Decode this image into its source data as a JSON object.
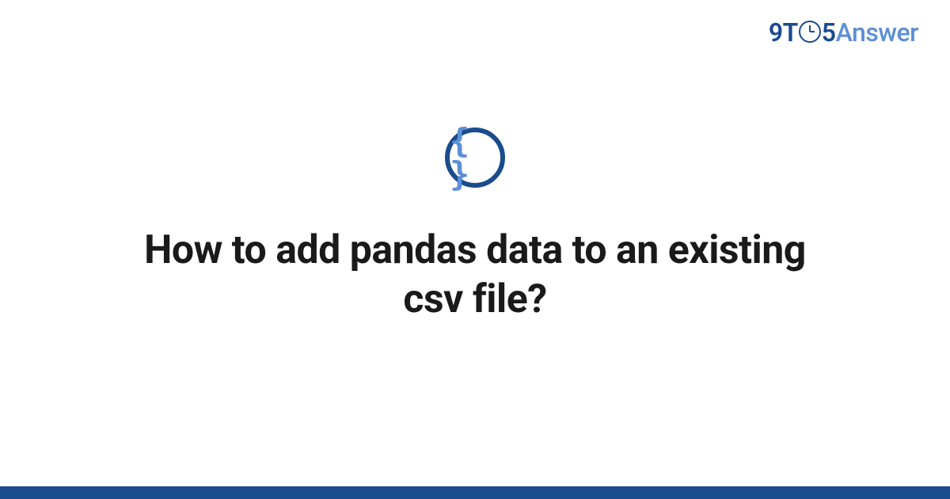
{
  "logo": {
    "prefix": "9T",
    "suffix": "5",
    "brand": "Answer"
  },
  "icon": {
    "braces": "{ }",
    "name": "code-braces-icon"
  },
  "title": "How to add pandas data to an existing csv file?",
  "colors": {
    "primary": "#1a4b8c",
    "accent": "#5b8fd6"
  }
}
